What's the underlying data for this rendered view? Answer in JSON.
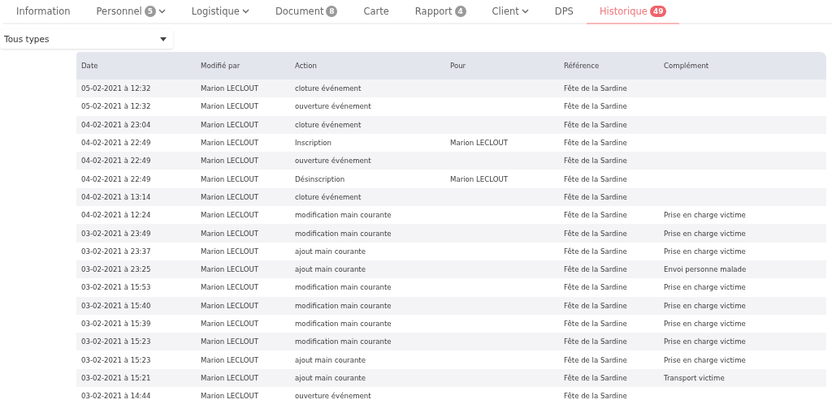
{
  "tabs": [
    {
      "label": "Information",
      "selected": false
    },
    {
      "label": "Personnel",
      "badge": "5",
      "dropdown": true,
      "selected": false
    },
    {
      "label": "Logistique",
      "dropdown": true,
      "selected": false
    },
    {
      "label": "Document",
      "badge": "8",
      "selected": false
    },
    {
      "label": "Carte",
      "selected": false
    },
    {
      "label": "Rapport",
      "badge": "4",
      "selected": false
    },
    {
      "label": "Client",
      "dropdown": true,
      "selected": false
    },
    {
      "label": "DPS",
      "selected": false
    },
    {
      "label": "Historique",
      "badge": "49",
      "selected": true
    }
  ],
  "filter": {
    "value": "Tous types"
  },
  "table": {
    "columns": [
      "Date",
      "Modifié par",
      "Action",
      "Pour",
      "Référence",
      "Complément"
    ],
    "rows": [
      {
        "date": "05-02-2021 à 12:32",
        "by": "Marion LECLOUT",
        "action": "cloture événement",
        "reference": "Fête de la Sardine"
      },
      {
        "date": "05-02-2021 à 12:32",
        "by": "Marion LECLOUT",
        "action": "ouverture événement",
        "reference": "Fête de la Sardine"
      },
      {
        "date": "04-02-2021 à 23:04",
        "by": "Marion LECLOUT",
        "action": "cloture événement",
        "reference": "Fête de la Sardine"
      },
      {
        "date": "04-02-2021 à 22:49",
        "by": "Marion LECLOUT",
        "action": "Inscription",
        "for": "Marion LECLOUT",
        "reference": "Fête de la Sardine"
      },
      {
        "date": "04-02-2021 à 22:49",
        "by": "Marion LECLOUT",
        "action": "ouverture événement",
        "reference": "Fête de la Sardine"
      },
      {
        "date": "04-02-2021 à 22:49",
        "by": "Marion LECLOUT",
        "action": "Désinscription",
        "for": "Marion LECLOUT",
        "reference": "Fête de la Sardine"
      },
      {
        "date": "04-02-2021 à 13:14",
        "by": "Marion LECLOUT",
        "action": "cloture événement",
        "reference": "Fête de la Sardine"
      },
      {
        "date": "04-02-2021 à 12:24",
        "by": "Marion LECLOUT",
        "action": "modification main courante",
        "reference": "Fête de la Sardine",
        "complement": "Prise en charge victime"
      },
      {
        "date": "03-02-2021 à 23:49",
        "by": "Marion LECLOUT",
        "action": "modification main courante",
        "reference": "Fête de la Sardine",
        "complement": "Prise en charge victime"
      },
      {
        "date": "03-02-2021 à 23:37",
        "by": "Marion LECLOUT",
        "action": "ajout main courante",
        "reference": "Fête de la Sardine",
        "complement": "Prise en charge victime"
      },
      {
        "date": "03-02-2021 à 23:25",
        "by": "Marion LECLOUT",
        "action": "ajout main courante",
        "reference": "Fête de la Sardine",
        "complement": "Envoi personne malade"
      },
      {
        "date": "03-02-2021 à 15:53",
        "by": "Marion LECLOUT",
        "action": "modification main courante",
        "reference": "Fête de la Sardine",
        "complement": "Prise en charge victime"
      },
      {
        "date": "03-02-2021 à 15:40",
        "by": "Marion LECLOUT",
        "action": "modification main courante",
        "reference": "Fête de la Sardine",
        "complement": "Prise en charge victime"
      },
      {
        "date": "03-02-2021 à 15:39",
        "by": "Marion LECLOUT",
        "action": "modification main courante",
        "reference": "Fête de la Sardine",
        "complement": "Prise en charge victime"
      },
      {
        "date": "03-02-2021 à 15:23",
        "by": "Marion LECLOUT",
        "action": "modification main courante",
        "reference": "Fête de la Sardine",
        "complement": "Prise en charge victime"
      },
      {
        "date": "03-02-2021 à 15:23",
        "by": "Marion LECLOUT",
        "action": "ajout main courante",
        "reference": "Fête de la Sardine",
        "complement": "Prise en charge victime"
      },
      {
        "date": "03-02-2021 à 15:21",
        "by": "Marion LECLOUT",
        "action": "ajout main courante",
        "reference": "Fête de la Sardine",
        "complement": "Transport victime"
      },
      {
        "date": "03-02-2021 à 14:44",
        "by": "Marion LECLOUT",
        "action": "ouverture événement",
        "reference": "Fête de la Sardine"
      }
    ]
  }
}
